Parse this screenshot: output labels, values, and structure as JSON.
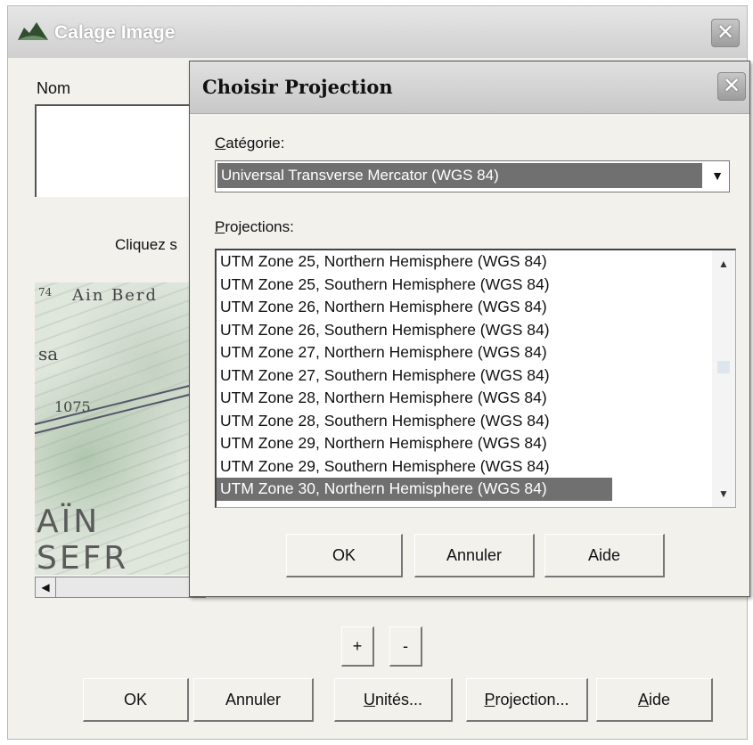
{
  "outer": {
    "title": "Calage Image",
    "nom_label": "Nom",
    "click_text": "Cliquez s",
    "map_labels": [
      "Ain Berd",
      "74",
      "sa",
      "1075",
      "AÏN SEFR"
    ],
    "small_buttons": [
      "+",
      "-"
    ],
    "buttons": {
      "ok": "OK",
      "cancel": "Annuler",
      "units_u": "U",
      "units_rest": "nités...",
      "projection_p": "P",
      "projection_rest": "rojection...",
      "help_a": "A",
      "help_rest": "ide"
    },
    "close_glyph": "✕"
  },
  "dialog": {
    "title": "Choisir Projection",
    "close_glyph": "✕",
    "category_label_first": "C",
    "category_label_rest": "atégorie:",
    "category_value": "Universal Transverse Mercator (WGS 84)",
    "projections_label_first": "P",
    "projections_label_rest": "rojections:",
    "projections": [
      "UTM Zone 25, Northern Hemisphere (WGS 84)",
      "UTM Zone 25, Southern Hemisphere (WGS 84)",
      "UTM Zone 26, Northern Hemisphere (WGS 84)",
      "UTM Zone 26, Southern Hemisphere (WGS 84)",
      "UTM Zone 27, Northern Hemisphere (WGS 84)",
      "UTM Zone 27, Southern Hemisphere (WGS 84)",
      "UTM Zone 28, Northern Hemisphere (WGS 84)",
      "UTM Zone 28, Southern Hemisphere (WGS 84)",
      "UTM Zone 29, Northern Hemisphere (WGS 84)",
      "UTM Zone 29, Southern Hemisphere (WGS 84)",
      "UTM Zone 30, Northern Hemisphere (WGS 84)"
    ],
    "selected_projection": "UTM Zone 30, Northern Hemisphere (WGS 84)",
    "buttons": {
      "ok": "OK",
      "cancel": "Annuler",
      "help": "Aide"
    }
  }
}
